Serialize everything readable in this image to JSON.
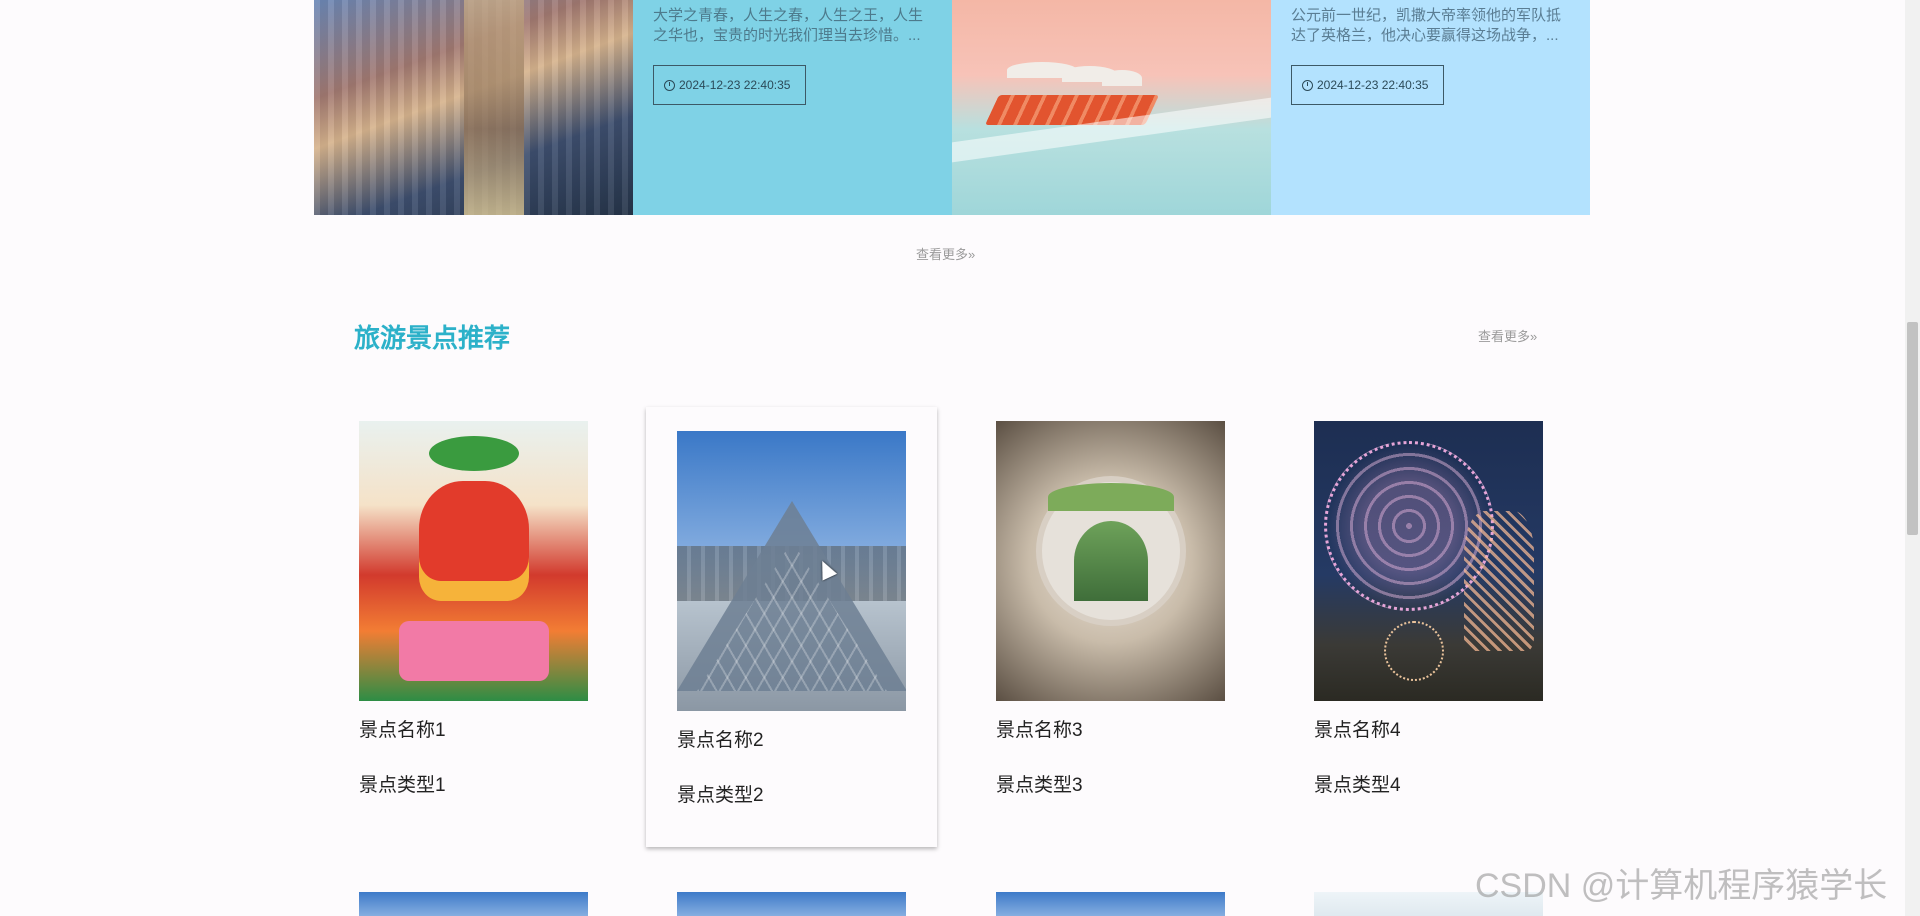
{
  "news": {
    "items": [
      {
        "desc": "大学之青春，人生之春，人生之王，人生之华也，宝贵的时光我们理当去珍惜。...",
        "time": "2024-12-23 22:40:35"
      },
      {
        "desc": "公元前一世纪，凯撒大帝率领他的军队抵达了英格兰，他决心要赢得这场战争，...",
        "time": "2024-12-23 22:40:35"
      }
    ],
    "more_label": "查看更多»"
  },
  "attractions": {
    "title": "旅游景点推荐",
    "more_label": "查看更多»",
    "cards": [
      {
        "name": "景点名称1",
        "type": "景点类型1"
      },
      {
        "name": "景点名称2",
        "type": "景点类型2"
      },
      {
        "name": "景点名称3",
        "type": "景点类型3"
      },
      {
        "name": "景点名称4",
        "type": "景点类型4"
      }
    ]
  },
  "watermark": "CSDN @计算机程序猿学长",
  "colors": {
    "accent": "#2cb1c9",
    "news_teal": "#7fd2e6",
    "news_blue": "#b3e2fe"
  },
  "icons": {
    "time": "clock-icon",
    "cursor": "mouse-cursor-icon"
  }
}
